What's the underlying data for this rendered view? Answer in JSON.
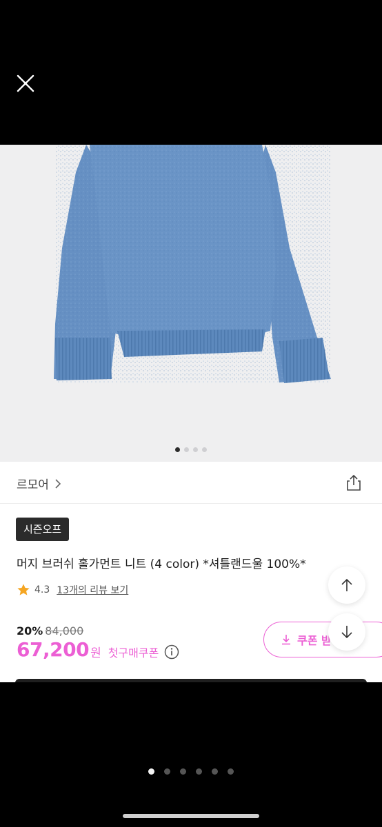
{
  "gallery": {
    "image_alt": "blue brushed knit sweater",
    "dot_count": 4,
    "active_dot": 0
  },
  "brand": {
    "name": "르모어"
  },
  "product": {
    "badge": "시즌오프",
    "title": "머지 브러쉬 홀가먼트 니트 (4 color) *셔틀랜드울 100%*",
    "rating": "4.3",
    "review_link": "13개의 리뷰 보기",
    "discount": "20%",
    "original_price": "84,000",
    "price": "67,200",
    "currency": "원",
    "first_purchase": "첫구매쿠폰",
    "coupon_button": "쿠폰 받"
  },
  "colors": {
    "accent": "#ec5fd4",
    "star": "#f5a623",
    "badge_bg": "#2b2b2b"
  },
  "viewer": {
    "page_count": 6,
    "active_page": 0
  }
}
